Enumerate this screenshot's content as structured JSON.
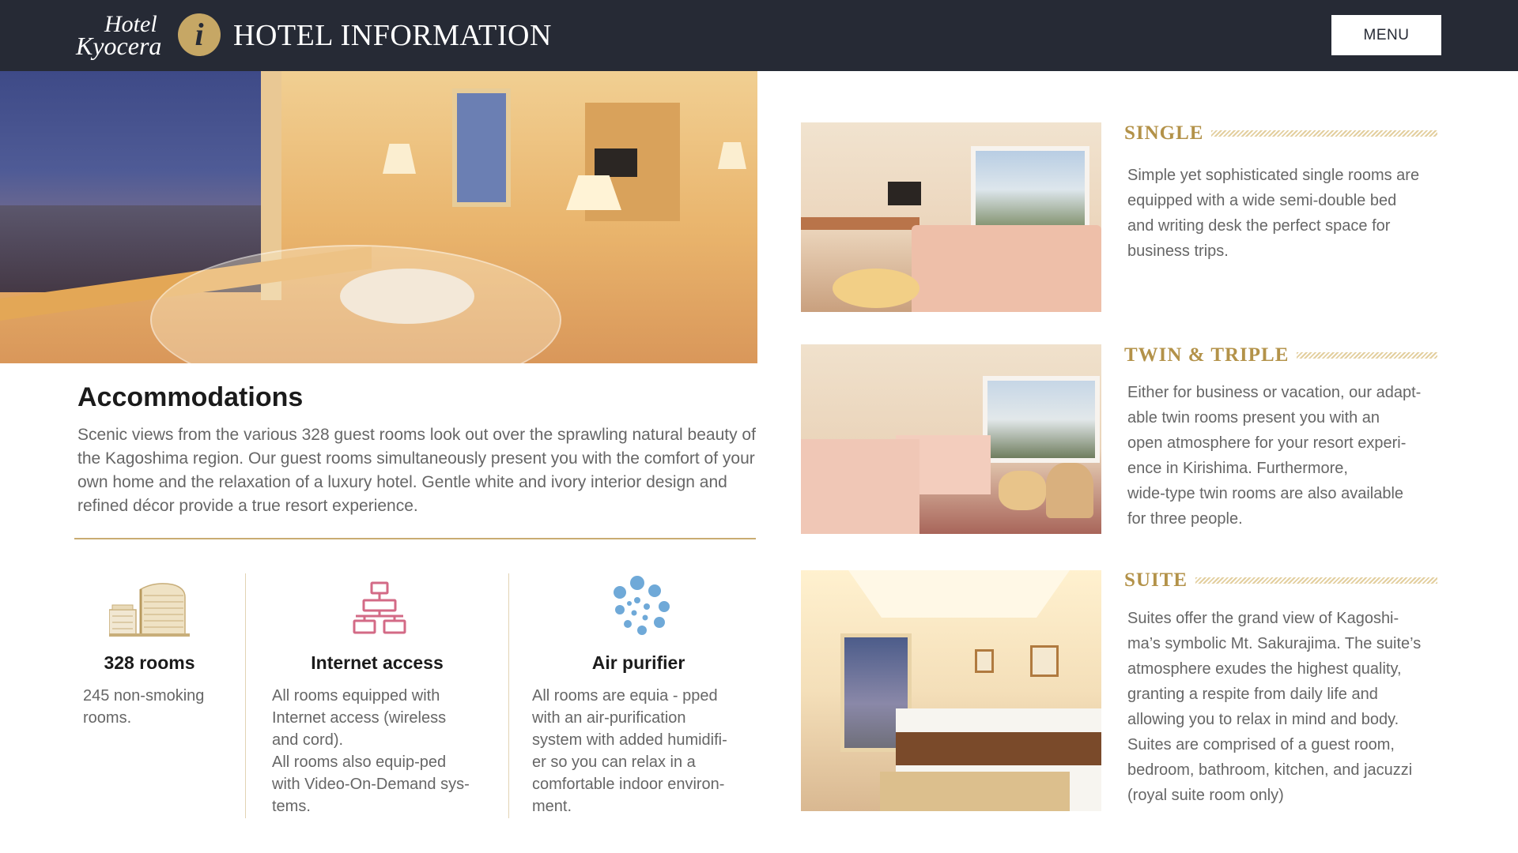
{
  "header": {
    "logo_line1": "Hotel",
    "logo_line2": "Kyocera",
    "info_glyph": "i",
    "title": "HOTEL INFORMATION",
    "menu_label": "MENU"
  },
  "accommodations": {
    "title": "Accommodations",
    "body": "Scenic views from the various 328 guest rooms look out over the sprawling natural beauty of the Kagoshima region. Our guest rooms simultaneously present you with the comfort of your own home and the relaxation of a luxury hotel. Gentle white and ivory interior design and refined décor provide a true resort experience."
  },
  "features": [
    {
      "icon": "hotel-building-icon",
      "title": "328 rooms",
      "desc": "245 non-smoking\nrooms."
    },
    {
      "icon": "network-icon",
      "title": "Internet access",
      "desc": "All rooms equipped with\nInternet access (wireless\nand cord).\nAll rooms also equip-ped\nwith Video-On-Demand sys-\ntems."
    },
    {
      "icon": "air-purifier-icon",
      "title": "Air purifier",
      "desc": "All rooms are equia - pped\nwith an air-purification\nsystem with added humidifi-\ner so you can relax in a\ncomfortable indoor environ-\nment."
    }
  ],
  "rooms": [
    {
      "name": "SINGLE",
      "desc": "Simple yet sophisticated single rooms are\nequipped with a wide semi-double bed\nand writing desk the perfect space for\nbusiness trips."
    },
    {
      "name": "TWIN & TRIPLE",
      "desc": "Either for business or vacation, our adapt-\nable twin rooms present you with an\nopen atmosphere for your resort experi-\nence in Kirishima. Furthermore,\nwide-type twin rooms are also available\nfor three people."
    },
    {
      "name": "SUITE",
      "desc": "Suites offer the grand view of Kagoshi-\nma’s symbolic Mt. Sakurajima. The suite’s\natmosphere exudes the highest quality,\ngranting a respite from daily life and\nallowing you to relax in mind and body.\nSuites are comprised of a guest room,\nbedroom, bathroom, kitchen, and jacuzzi\n(royal suite room only)"
    }
  ],
  "colors": {
    "header_bg": "#262a35",
    "accent_gold": "#c6a765",
    "room_heading": "#b39249",
    "network_icon": "#d36a86",
    "purifier_icon": "#6fa9d8"
  }
}
